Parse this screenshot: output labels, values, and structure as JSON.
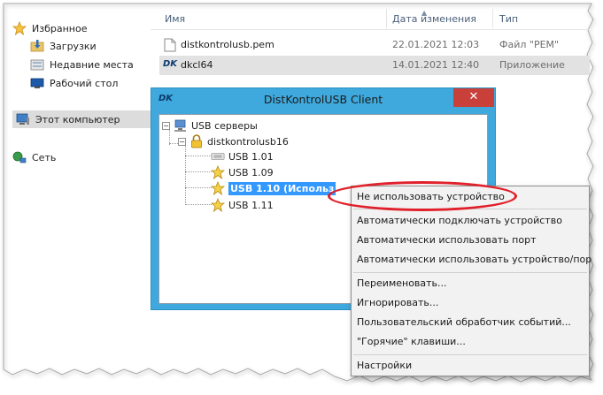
{
  "sidebar": {
    "favorites_label": "Избранное",
    "items": [
      {
        "label": "Загрузки",
        "icon": "downloads-folder-icon"
      },
      {
        "label": "Недавние места",
        "icon": "recent-places-icon"
      },
      {
        "label": "Рабочий стол",
        "icon": "desktop-icon"
      }
    ],
    "computer_label": "Этот компьютер",
    "network_label": "Сеть"
  },
  "filelist": {
    "columns": [
      "Имя",
      "Дата изменения",
      "Тип"
    ],
    "rows": [
      {
        "name": "distkontrolusb.pem",
        "date": "22.01.2021 12:03",
        "type": "Файл \"PEM\"",
        "icon": "document-icon"
      },
      {
        "name": "dkcl64",
        "date": "14.01.2021 12:40",
        "type": "Приложение",
        "icon": "app-icon"
      }
    ]
  },
  "dialog": {
    "title": "DistKontrolUSB Client",
    "icon_text": "DK",
    "close_label": "✕",
    "tree": {
      "root": "USB серверы",
      "server": "distkontrolusb16",
      "ports": [
        "USB 1.01",
        "USB 1.09",
        "USB 1.10 (Использ",
        "USB 1.11"
      ]
    }
  },
  "context_menu": {
    "items": [
      "Не использовать устройство",
      "Автоматически подключать устройство",
      "Автоматически использовать порт",
      "Автоматически использовать устройство/пор",
      "Переименовать...",
      "Игнорировать...",
      "Пользовательский обработчик событий...",
      "\"Горячие\" клавиши...",
      "Настройки"
    ]
  },
  "colors": {
    "dialog_border": "#3fa9dd",
    "close_button": "#c9403b",
    "selection": "#3399ff",
    "highlight_ellipse": "#e0202a"
  }
}
